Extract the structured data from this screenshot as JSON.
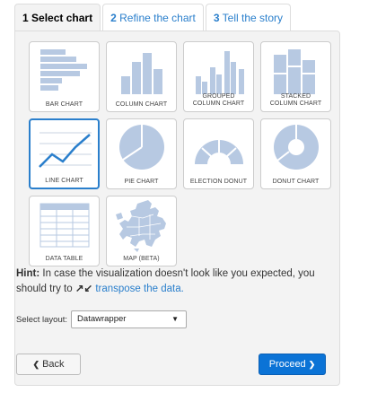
{
  "tabs": [
    {
      "num": "1",
      "label": "Select chart"
    },
    {
      "num": "2",
      "label": "Refine the chart"
    },
    {
      "num": "3",
      "label": "Tell the story"
    }
  ],
  "charts": [
    {
      "label": "BAR CHART"
    },
    {
      "label": "COLUMN CHART"
    },
    {
      "label_line1": "GROUPED",
      "label_line2": "COLUMN CHART"
    },
    {
      "label_line1": "STACKED",
      "label_line2": "COLUMN CHART"
    },
    {
      "label": "LINE CHART"
    },
    {
      "label": "PIE CHART"
    },
    {
      "label": "ELECTION DONUT"
    },
    {
      "label": "DONUT CHART"
    },
    {
      "label": "DATA TABLE"
    },
    {
      "label": "MAP (BETA)"
    }
  ],
  "hint": {
    "prefix": "Hint:",
    "text": " In case the visualization doesn't look like you expected, you should try to ",
    "link": "transpose the data."
  },
  "layout": {
    "label": "Select layout:",
    "value": "Datawrapper"
  },
  "buttons": {
    "back": "Back",
    "proceed": "Proceed"
  },
  "colors": {
    "accent": "#2a7fcc",
    "icon_fill": "#b7c9e2",
    "proceed_bg": "#0b73d6"
  }
}
